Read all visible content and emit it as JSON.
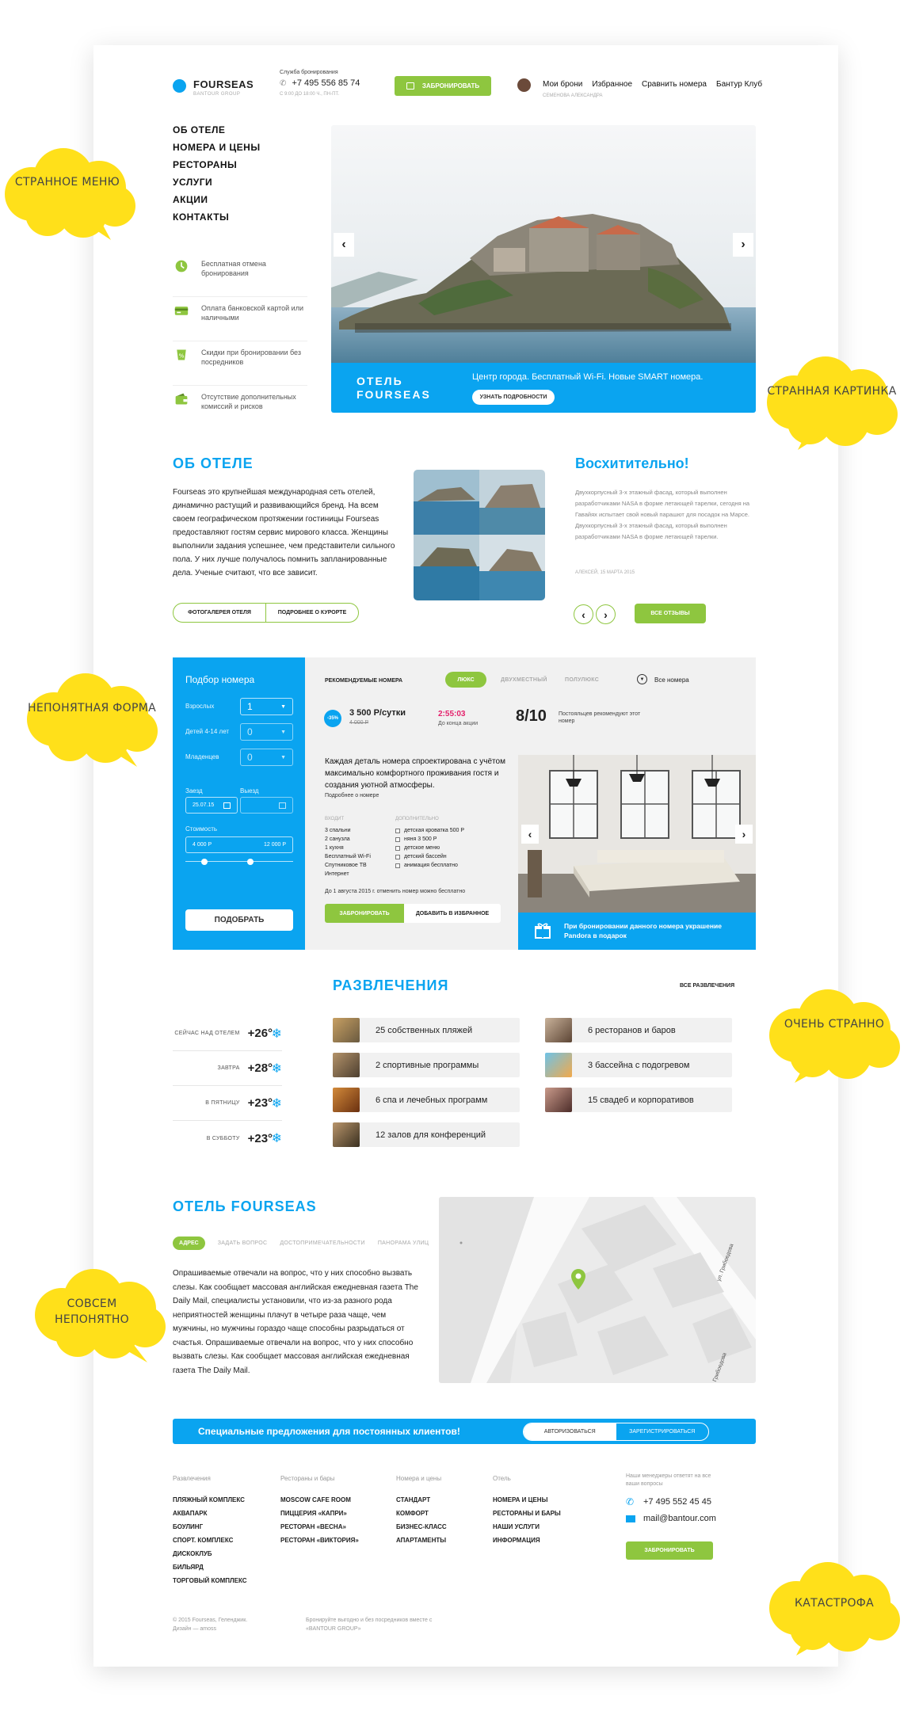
{
  "brand": {
    "name": "FOURSEAS",
    "sub": "BANTOUR GROUP"
  },
  "header": {
    "booking_label": "Служба бронирования",
    "phone": "+7 495 556 85 74",
    "hours": "С 9:00 ДО 18:00 Ч., ПН-ПТ.",
    "book_button": "ЗАБРОНИРОВАТЬ",
    "user_name": "СЕМЕНОВА АЛЕКСАНДРА",
    "nav": [
      "Мои брони",
      "Избранное",
      "Сравнить номера",
      "Бантур Клуб"
    ]
  },
  "menu": [
    "ОБ ОТЕЛЕ",
    "НОМЕРА И ЦЕНЫ",
    "РЕСТОРАНЫ",
    "УСЛУГИ",
    "АКЦИИ",
    "КОНТАКТЫ"
  ],
  "features": [
    {
      "text": "Бесплатная отмена бронирования",
      "icon": "clock-icon"
    },
    {
      "text": "Оплата банковской картой или наличными",
      "icon": "card-icon"
    },
    {
      "text": "Скидки при бронировании без посредников",
      "icon": "discount-icon"
    },
    {
      "text": "Отсутствие дополнительных комиссий и рисков",
      "icon": "wallet-icon"
    }
  ],
  "hero": {
    "title_line1": "ОТЕЛЬ",
    "title_line2": "FOURSEAS",
    "tagline": "Центр города. Бесплатный Wi-Fi. Новые SMART номера.",
    "button": "УЗНАТЬ ПОДРОБНОСТИ"
  },
  "about": {
    "title": "ОБ ОТЕЛЕ",
    "text": "Fourseas это крупнейшая международная сеть отелей, динамично растущий и развивающийся бренд. На всем своем географическом протяжении гостиницы Fourseas предоставляют гостям сервис мирового класса. Женщины выполнили задания успешнее, чем представители сильного пола. У них лучше получалось помнить запланированные дела. Ученые считают, что все зависит.",
    "btn_gallery": "ФОТОГАЛЕРЕЯ ОТЕЛЯ",
    "btn_resort": "ПОДРОБНЕЕ О КУРОРТЕ"
  },
  "review": {
    "title": "Восхитительно!",
    "text": "Двухкорпусный 3-х этажный фасад, который выполнен разработчиками NASA в форме летающей тарелки, сегодня на Гавайях испытает свой новый парашют для посадок на Марсе. Двухкорпусный 3-х этажный фасад, который выполнен разработчиками NASA в форме летающей тарелки.",
    "author": "АЛЕКСЕЙ, 15 МАРТА 2015",
    "all_button": "ВСЕ ОТЗЫВЫ"
  },
  "search": {
    "title": "Подбор номера",
    "adults_label": "Взрослых",
    "adults": "1",
    "kids_label": "Детей 4-14 лет",
    "kids": "0",
    "infants_label": "Младенцев",
    "infants": "0",
    "checkin_label": "Заезд",
    "checkin": "25.07.15",
    "checkout_label": "Выезд",
    "checkout": "",
    "cost_label": "Стоимость",
    "price_from": "4 000 Р",
    "price_to": "12 000 Р",
    "range": [
      0.18,
      0.6
    ],
    "button": "ПОДОБРАТЬ"
  },
  "rooms": {
    "title": "РЕКОМЕНДУЕМЫЕ НОМЕРА",
    "tabs": [
      "ЛЮКС",
      "ДВУХМЕСТНЫЙ",
      "ПОЛУЛЮКС"
    ],
    "all": "Все номера",
    "discount": "-35%",
    "price": "3 500 Р/сутки",
    "old_price": "4 000 Р",
    "timer": "2:55:03",
    "timer_label": "До конца акции",
    "rating": "8/10",
    "rating_label": "Постояльцев рекомендуют этот номер",
    "heading": "Каждая деталь номера спроектирована с учётом максимально комфортного проживания гостя и создания уютной атмосферы.",
    "more": "Подробнее о номере",
    "included_label": "ВХОДИТ",
    "included": [
      "3 спальни",
      "2 санузла",
      "1 кухня",
      "Бесплатный Wi-Fi",
      "Спутниковое ТВ",
      "Интернет"
    ],
    "extra_label": "ДОПОЛНИТЕЛЬНО",
    "extra": [
      "детская кроватка 500 Р",
      "няня 3 500 Р",
      "детское меню",
      "детский бассейн",
      "анимация бесплатно"
    ],
    "cancel_note": "До 1 августа 2015 г. отменить номер можно бесплатно",
    "book_button": "ЗАБРОНИРОВАТЬ",
    "fav_button": "ДОБАВИТЬ В ИЗБРАННОЕ",
    "gift_text": "При бронировании данного номера украшение Pandora в подарок"
  },
  "fun": {
    "title": "РАЗВЛЕЧЕНИЯ",
    "all": "ВСЕ РАЗВЛЕЧЕНИЯ",
    "items_left": [
      "25 собственных пляжей",
      "2 спортивные программы",
      "6 спа и лечебных программ",
      "12 залов для конференций"
    ],
    "items_right": [
      "6 ресторанов и баров",
      "3 бассейна с подогревом",
      "15 свадеб и корпоративов"
    ]
  },
  "weather": [
    {
      "day": "СЕЙЧАС НАД ОТЕЛЕМ",
      "temp": "+26°"
    },
    {
      "day": "ЗАВТРА",
      "temp": "+28°"
    },
    {
      "day": "В ПЯТНИЦУ",
      "temp": "+23°"
    },
    {
      "day": "В СУББОТУ",
      "temp": "+23°"
    }
  ],
  "location": {
    "title": "ОТЕЛЬ FOURSEAS",
    "tabs": [
      "АДРЕС",
      "ЗАДАТЬ ВОПРОС",
      "ДОСТОПРИМЕЧАТЕЛЬНОСТИ",
      "ПАНОРАМА УЛИЦ"
    ],
    "text": "Опрашиваемые отвечали на вопрос, что у них способно вызвать слезы. Как сообщает массовая английская ежедневная газета The Daily Mail, специалисты установили, что из-за разного рода неприятностей женщины плачут в четыре раза чаще, чем мужчины, но мужчины гораздо чаще способны разрыдаться от счастья. Опрашиваемые отвечали на вопрос, что у них способно вызвать слезы. Как сообщает массовая английская ежедневная газета The Daily Mail.",
    "street1": "ул. Грибоедова",
    "street2": "Грибоедова"
  },
  "offer": {
    "text": "Специальные предложения для постоянных клиентов!",
    "login": "АВТОРИЗОВАТЬСЯ",
    "register": "ЗАРЕГИСТРИРОВАТЬСЯ"
  },
  "footer": {
    "col1": {
      "h": "Развлечения",
      "items": [
        "ПЛЯЖНЫЙ КОМПЛЕКС",
        "АКВАПАРК",
        "БОУЛИНГ",
        "СПОРТ. КОМПЛЕКС",
        "ДИСКОКЛУБ",
        "БИЛЬЯРД",
        "ТОРГОВЫЙ КОМПЛЕКС"
      ]
    },
    "col2": {
      "h": "Рестораны и бары",
      "items": [
        "MOSCOW CAFE ROOM",
        "ПИЦЦЕРИЯ «КАПРИ»",
        "РЕСТОРАН «ВЕСНА»",
        "РЕСТОРАН «ВИКТОРИЯ»"
      ]
    },
    "col3": {
      "h": "Номера и цены",
      "items": [
        "СТАНДАРТ",
        "КОМФОРТ",
        "БИЗНЕС-КЛАСС",
        "АПАРТАМЕНТЫ"
      ]
    },
    "col4": {
      "h": "Отель",
      "items": [
        "НОМЕРА И ЦЕНЫ",
        "РЕСТОРАНЫ И БАРЫ",
        "НАШИ УСЛУГИ",
        "ИНФОРМАЦИЯ"
      ]
    },
    "contact_note": "Наши менеджеры ответят на все ваши вопросы",
    "phone": "+7 495 552 45 45",
    "email": "mail@bantour.com",
    "book_button": "ЗАБРОНИРОВАТЬ",
    "copyright": "© 2015 Fourseas, Геленджик.",
    "design": "Дизайн — amoss",
    "book_note": "Бронируйте выгодно и без посредников вместе с «BANTOUR GROUP»"
  },
  "clouds": [
    "СТРАННОЕ МЕНЮ",
    "СТРАННАЯ КАРТИНКА",
    "НЕПОНЯТНАЯ ФОРМА",
    "ОЧЕНЬ СТРАННО",
    "СОВСЕМ НЕПОНЯТНО",
    "КАТАСТРОФА"
  ],
  "colors": {
    "accent": "#0aa4f0",
    "green": "#8ec63f",
    "cloud": "#ffe01a"
  }
}
